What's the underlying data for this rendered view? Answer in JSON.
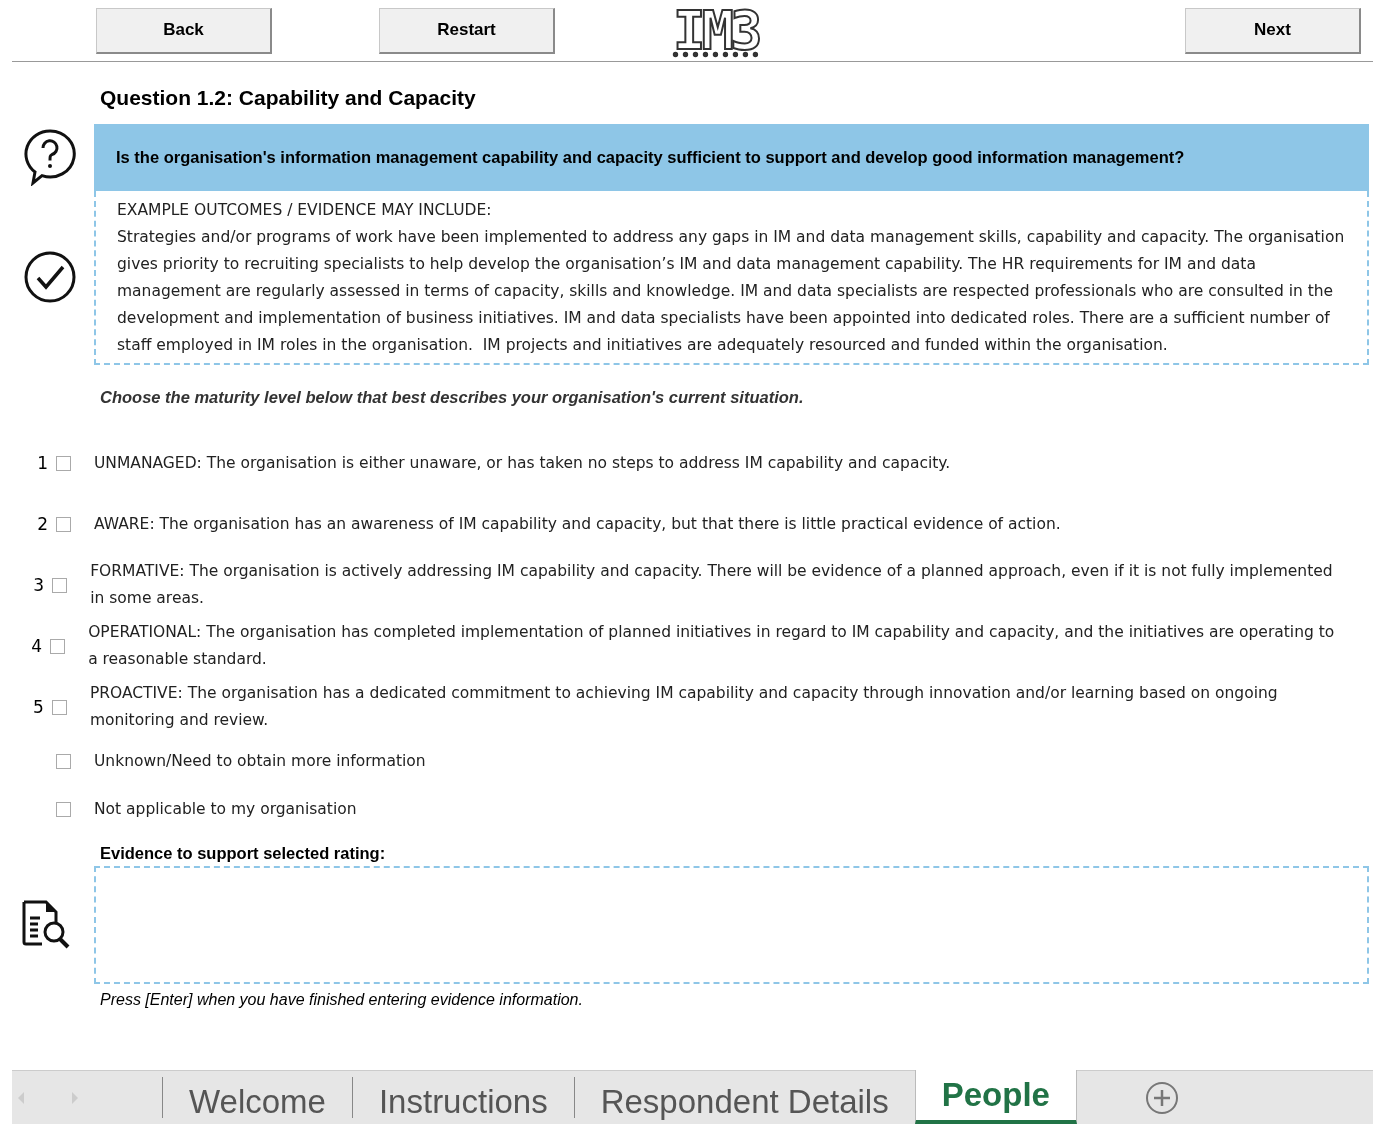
{
  "toolbar": {
    "buttons": [
      {
        "label": "Back"
      },
      {
        "label": "Restart"
      }
    ],
    "logo": "IM3",
    "next_button": "Next"
  },
  "question": {
    "title": "Question 1.2: Capability and Capacity",
    "prompt": "Is the organisation's information management capability and capacity sufficient to support and develop good information management?"
  },
  "evidence_examples": {
    "heading": "EXAMPLE OUTCOMES / EVIDENCE MAY INCLUDE:",
    "text": "Strategies and/or programs of work have been implemented to address any gaps in IM and data management skills, capability and capacity. The organisation gives priority to recruiting specialists to help develop the organisation’s IM and data management capability. The HR requirements for IM and data management are regularly assessed in terms of capacity, skills and knowledge. IM and data specialists are respected professionals who are consulted in the development and implementation of business initiatives. IM and data specialists have been appointed into dedicated roles. There are a sufficient number of staff employed in IM roles in the organisation.  IM projects and initiatives are adequately resourced and funded within the organisation."
  },
  "instruction": "Choose the maturity level below that best describes your organisation's current situation.",
  "options": [
    {
      "number": "1",
      "checked": false,
      "text": "UNMANAGED: The organisation is either unaware, or has taken no steps to address IM capability and capacity."
    },
    {
      "number": "2",
      "checked": false,
      "text": "AWARE: The organisation has an awareness of IM capability and capacity, but that there is little practical evidence of action."
    },
    {
      "number": "3",
      "checked": false,
      "text": "FORMATIVE: The organisation is actively addressing IM capability and capacity. There will be evidence of a planned approach, even if it is not fully implemented in some areas."
    },
    {
      "number": "4",
      "checked": false,
      "text": "OPERATIONAL: The organisation has completed implementation of planned initiatives in regard to IM capability and capacity, and the initiatives are operating to a reasonable standard."
    },
    {
      "number": "5",
      "checked": false,
      "text": "PROACTIVE: The organisation has a dedicated commitment to achieving IM capability and capacity through innovation and/or learning based on ongoing monitoring and review."
    },
    {
      "checked": false,
      "text": "Unknown/Need to obtain more information"
    },
    {
      "checked": false,
      "text": "Not applicable to my organisation"
    }
  ],
  "evidence": {
    "label": "Evidence to support selected rating:",
    "note": "Press [Enter] when you have finished entering evidence information."
  },
  "sheet_tabs": [
    {
      "label": "Welcome",
      "selected": false
    },
    {
      "label": "Instructions",
      "selected": false
    },
    {
      "label": "Respondent Details",
      "selected": false
    },
    {
      "label": "People",
      "selected": true
    }
  ]
}
